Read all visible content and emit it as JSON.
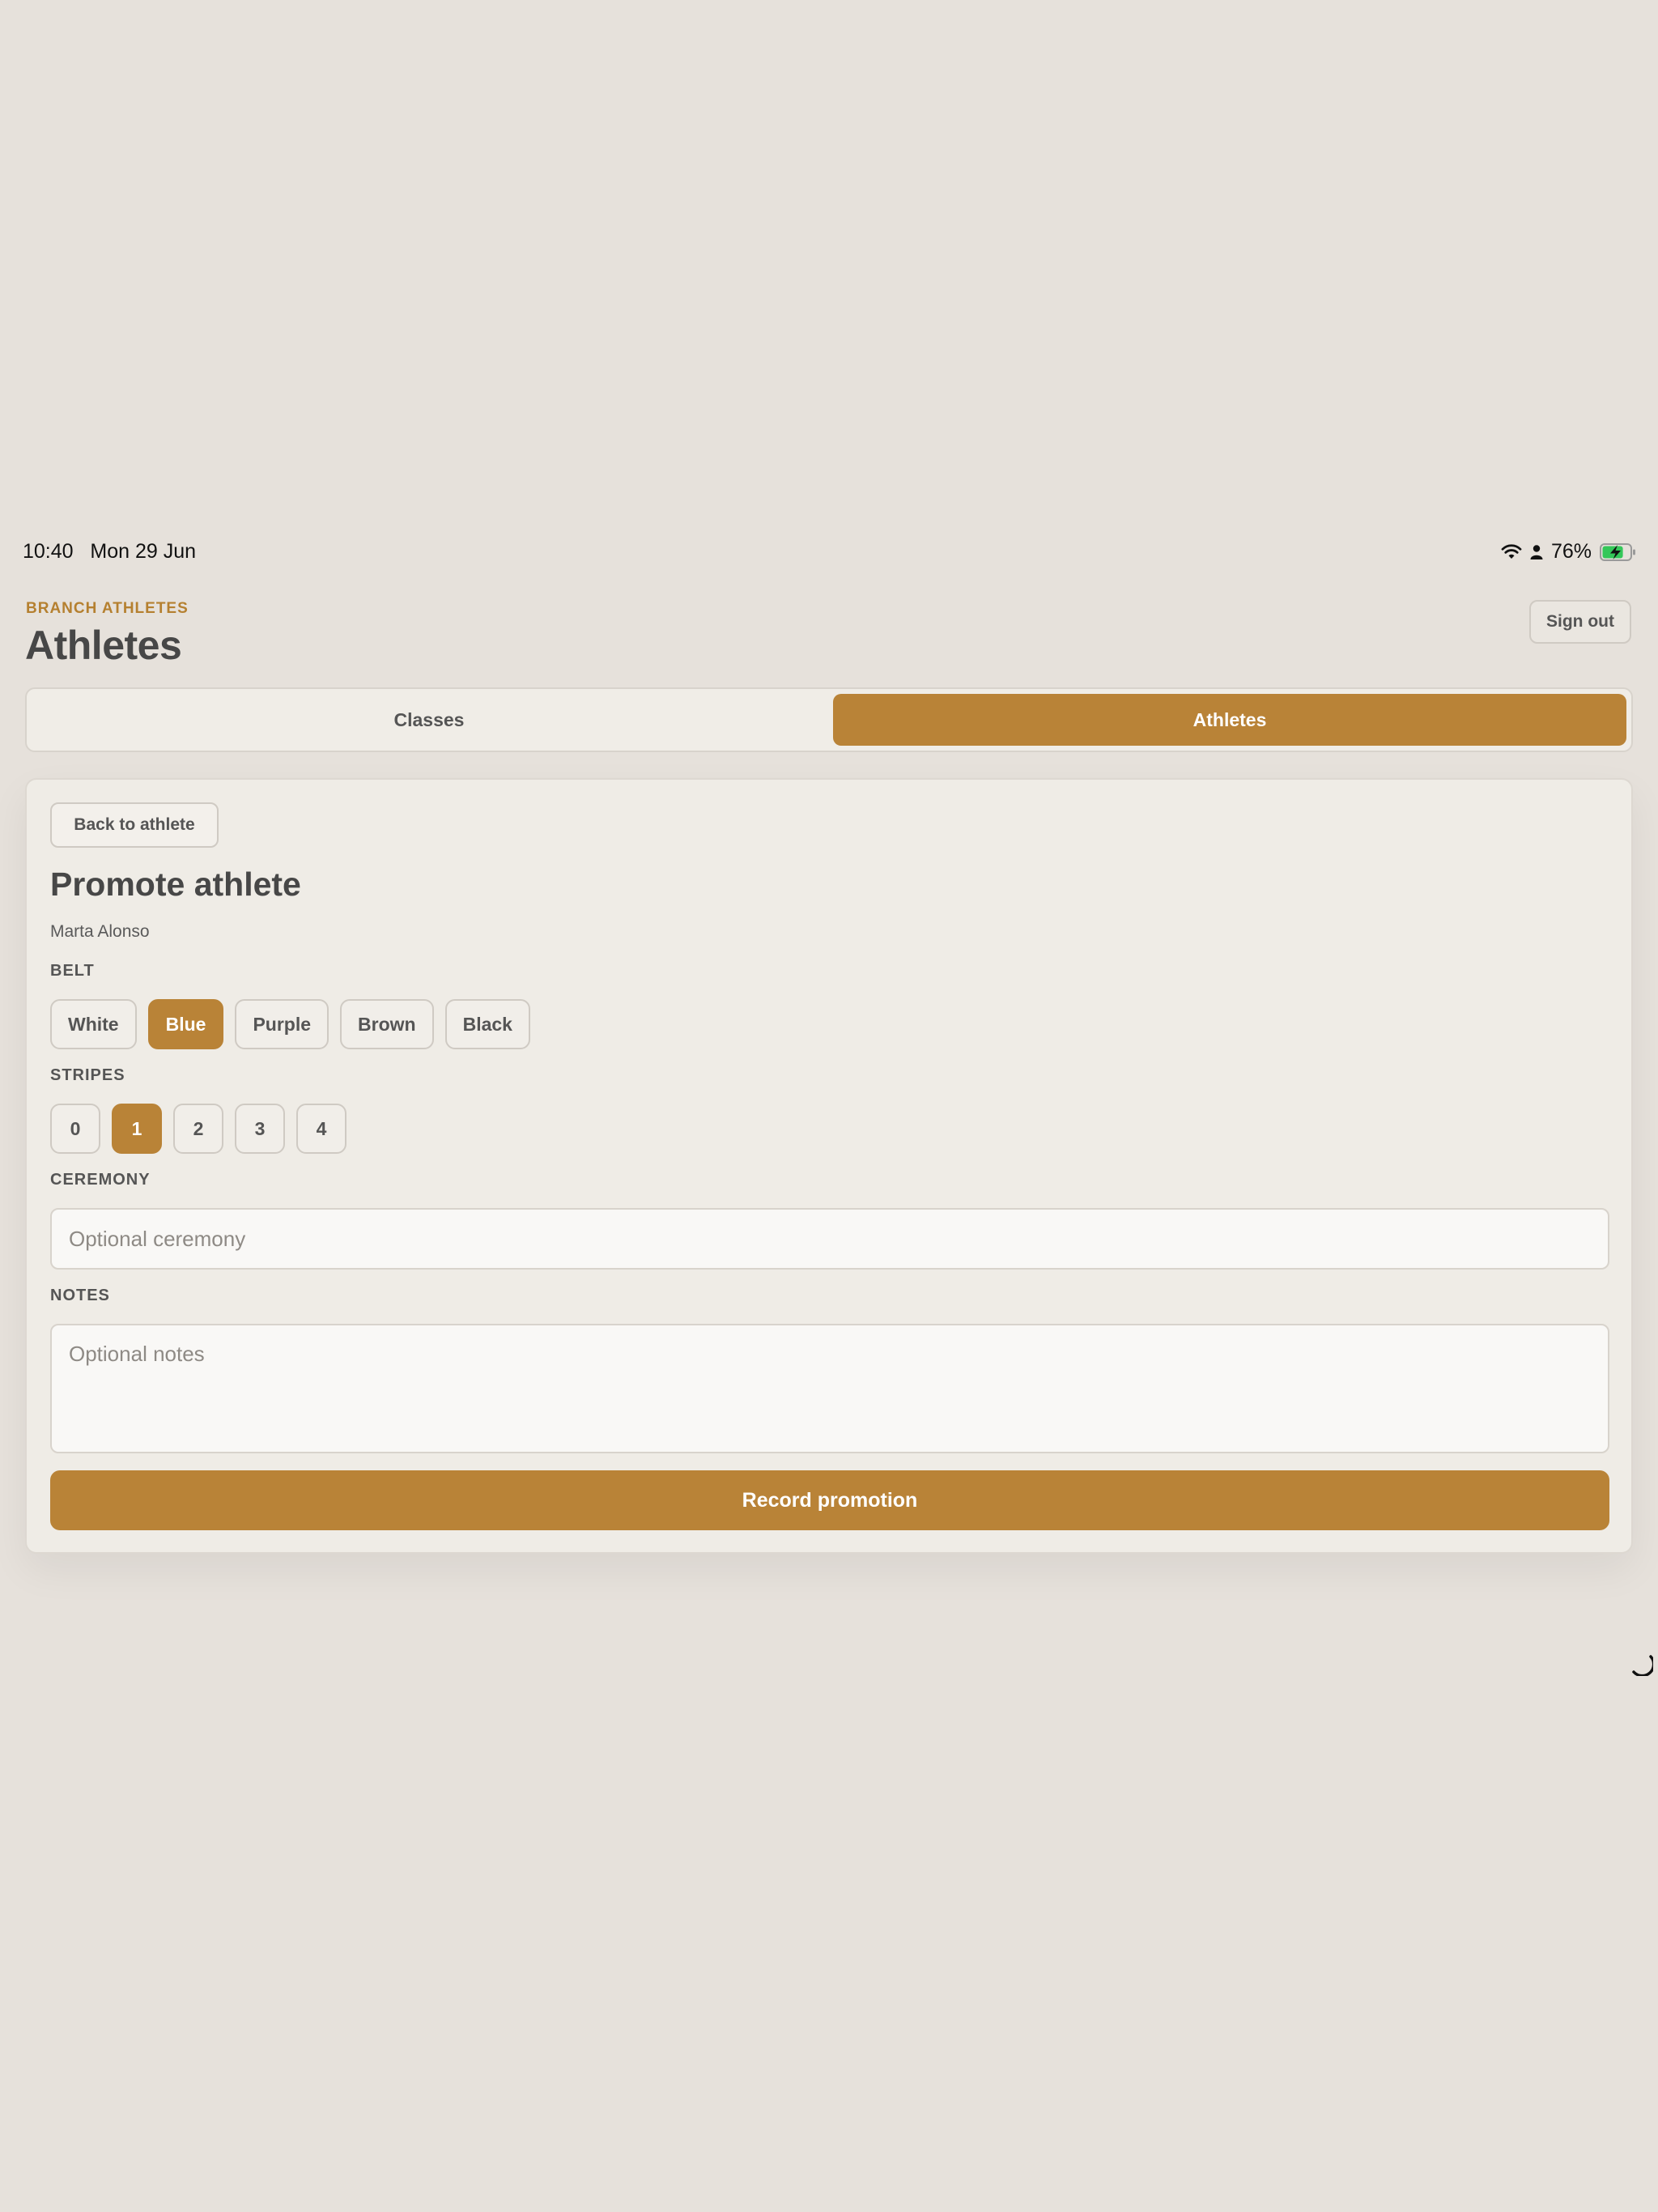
{
  "status_bar": {
    "time": "10:40",
    "date": "Mon 29 Jun",
    "battery_percent": "76%",
    "battery_level": 0.76,
    "charging": true,
    "battery_color": "#34c759"
  },
  "header": {
    "eyebrow": "BRANCH ATHLETES",
    "title": "Athletes",
    "sign_out_label": "Sign out"
  },
  "tabs": [
    {
      "label": "Classes",
      "selected": false
    },
    {
      "label": "Athletes",
      "selected": true
    }
  ],
  "form": {
    "back_label": "Back to athlete",
    "title": "Promote athlete",
    "athlete_name": "Marta Alonso",
    "belt": {
      "label": "BELT",
      "options": [
        "White",
        "Blue",
        "Purple",
        "Brown",
        "Black"
      ],
      "selected": "Blue"
    },
    "stripes": {
      "label": "STRIPES",
      "options": [
        "0",
        "1",
        "2",
        "3",
        "4"
      ],
      "selected": "1"
    },
    "ceremony": {
      "label": "CEREMONY",
      "value": "",
      "placeholder": "Optional ceremony"
    },
    "notes": {
      "label": "NOTES",
      "value": "",
      "placeholder": "Optional notes"
    },
    "submit_label": "Record promotion"
  },
  "colors": {
    "accent": "#b98337",
    "eyebrow": "#b58030",
    "background": "#e6e1db",
    "card": "#efece6"
  }
}
